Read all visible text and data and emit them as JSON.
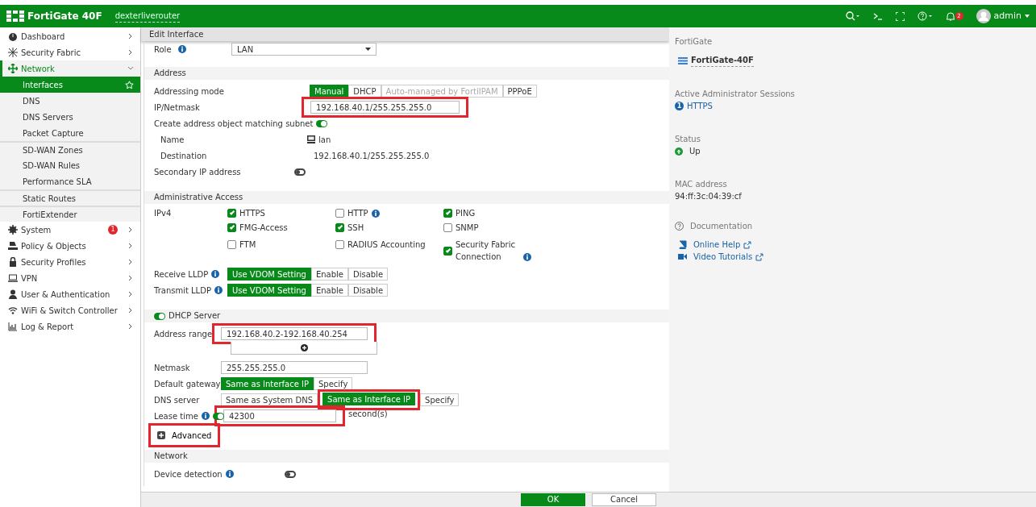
{
  "topbar": {
    "product": "FortiGate 40F",
    "hostname": "dexterliverouter",
    "notifications": "2",
    "user": "admin"
  },
  "sidebar": {
    "items": [
      {
        "label": "Dashboard",
        "selected": false,
        "expanded": false
      },
      {
        "label": "Security Fabric",
        "selected": false,
        "expanded": false
      },
      {
        "label": "Network",
        "selected": true,
        "expanded": true,
        "children": [
          {
            "label": "Interfaces",
            "selected": true
          },
          {
            "label": "DNS",
            "selected": false
          },
          {
            "label": "DNS Servers",
            "selected": false
          },
          {
            "label": "Packet Capture",
            "selected": false
          },
          {
            "label": "SD-WAN Zones",
            "selected": false
          },
          {
            "label": "SD-WAN Rules",
            "selected": false
          },
          {
            "label": "Performance SLA",
            "selected": false
          },
          {
            "label": "Static Routes",
            "selected": false
          },
          {
            "label": "FortiExtender",
            "selected": false
          }
        ]
      },
      {
        "label": "System",
        "selected": false,
        "expanded": false,
        "badge": "1"
      },
      {
        "label": "Policy & Objects",
        "selected": false,
        "expanded": false
      },
      {
        "label": "Security Profiles",
        "selected": false,
        "expanded": false
      },
      {
        "label": "VPN",
        "selected": false,
        "expanded": false
      },
      {
        "label": "User & Authentication",
        "selected": false,
        "expanded": false
      },
      {
        "label": "WiFi & Switch Controller",
        "selected": false,
        "expanded": false
      },
      {
        "label": "Log & Report",
        "selected": false,
        "expanded": false
      }
    ]
  },
  "panel_title": "Edit Interface",
  "role": {
    "label": "Role",
    "value": "LAN"
  },
  "address": {
    "title": "Address",
    "addressing_mode": {
      "label": "Addressing mode",
      "options": [
        {
          "label": "Manual",
          "selected": true,
          "disabled": false
        },
        {
          "label": "DHCP",
          "selected": false,
          "disabled": false
        },
        {
          "label": "Auto-managed by FortiIPAM",
          "selected": false,
          "disabled": true
        },
        {
          "label": "PPPoE",
          "selected": false,
          "disabled": false
        }
      ]
    },
    "ip_netmask": {
      "label": "IP/Netmask",
      "value": "192.168.40.1/255.255.255.0",
      "highlighted": true
    },
    "create_object": {
      "label": "Create address object matching subnet",
      "on": true
    },
    "object_name": {
      "label": "Name",
      "value": "lan"
    },
    "destination": {
      "label": "Destination",
      "value": "192.168.40.1/255.255.255.0"
    },
    "secondary_ip": {
      "label": "Secondary IP address",
      "on": false
    }
  },
  "admin_access": {
    "title": "Administrative Access",
    "ipv4_label": "IPv4",
    "options": [
      {
        "label": "HTTPS",
        "checked": true,
        "info": false
      },
      {
        "label": "HTTP",
        "checked": false,
        "info": true
      },
      {
        "label": "PING",
        "checked": true,
        "info": false
      },
      {
        "label": "FMG-Access",
        "checked": true,
        "info": false
      },
      {
        "label": "SSH",
        "checked": true,
        "info": false
      },
      {
        "label": "SNMP",
        "checked": false,
        "info": false
      },
      {
        "label": "FTM",
        "checked": false,
        "info": false
      },
      {
        "label": "RADIUS Accounting",
        "checked": false,
        "info": false
      },
      {
        "label": "Security Fabric Connection",
        "checked": true,
        "info": true
      }
    ],
    "lldp": [
      {
        "label": "Receive LLDP",
        "options": [
          {
            "label": "Use VDOM Setting",
            "selected": true
          },
          {
            "label": "Enable",
            "selected": false
          },
          {
            "label": "Disable",
            "selected": false
          }
        ]
      },
      {
        "label": "Transmit LLDP",
        "options": [
          {
            "label": "Use VDOM Setting",
            "selected": true
          },
          {
            "label": "Enable",
            "selected": false
          },
          {
            "label": "Disable",
            "selected": false
          }
        ]
      }
    ]
  },
  "dhcp": {
    "title": "DHCP Server",
    "on": true,
    "address_range": {
      "label": "Address range",
      "value": "192.168.40.2-192.168.40.254",
      "highlighted": true
    },
    "netmask": {
      "label": "Netmask",
      "value": "255.255.255.0"
    },
    "default_gateway": {
      "label": "Default gateway",
      "options": [
        {
          "label": "Same as Interface IP",
          "selected": true,
          "highlighted": false
        },
        {
          "label": "Specify",
          "selected": false,
          "highlighted": false
        }
      ]
    },
    "dns_server": {
      "label": "DNS server",
      "options": [
        {
          "label": "Same as System DNS",
          "selected": false,
          "highlighted": false
        },
        {
          "label": "Same as Interface IP",
          "selected": true,
          "highlighted": true
        },
        {
          "label": "Specify",
          "selected": false,
          "highlighted": false
        }
      ]
    },
    "lease_time": {
      "label": "Lease time",
      "on": true,
      "value": "42300",
      "unit": "second(s)",
      "highlighted": true
    },
    "advanced": {
      "label": "Advanced",
      "highlighted": true
    }
  },
  "network": {
    "title": "Network",
    "device_detection": {
      "label": "Device detection",
      "on": false
    }
  },
  "info_panel": {
    "device": {
      "title": "FortiGate",
      "value": "FortiGate-40F"
    },
    "sessions": {
      "title": "Active Administrator Sessions",
      "count": "1",
      "value": "HTTPS"
    },
    "status": {
      "title": "Status",
      "value": "Up"
    },
    "mac": {
      "title": "MAC address",
      "value": "94:ff:3c:04:39:cf"
    },
    "documentation": {
      "title": "Documentation",
      "links": [
        "Online Help",
        "Video Tutorials"
      ]
    }
  },
  "footer": {
    "buttons": [
      {
        "label": "OK",
        "kind": "primary"
      },
      {
        "label": "Cancel",
        "kind": "secondary"
      }
    ]
  }
}
